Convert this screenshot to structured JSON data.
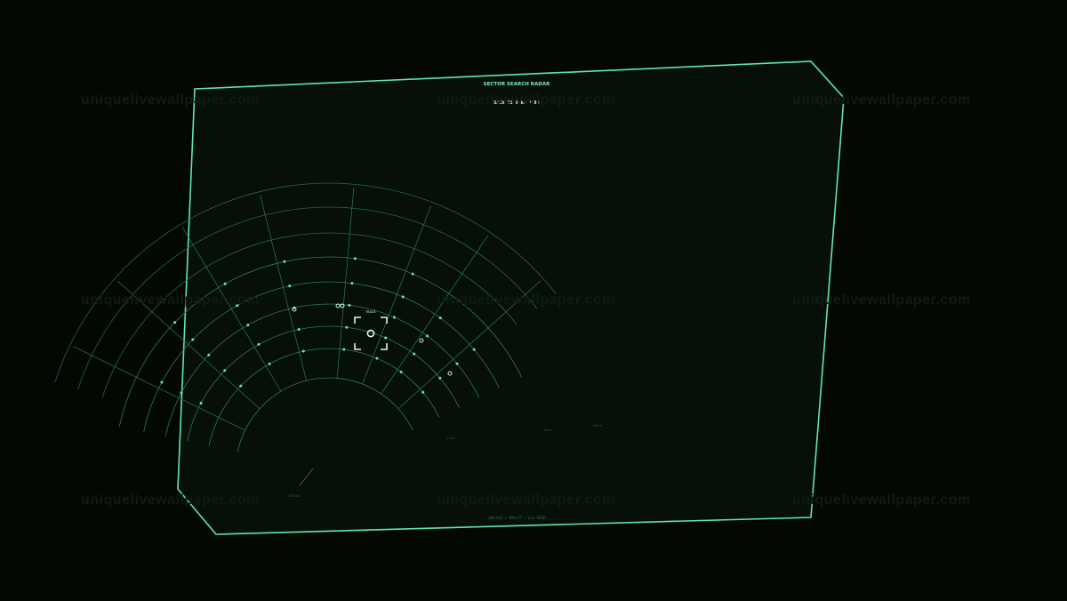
{
  "colors": {
    "background": "#030803",
    "panel_fill": "#060f08",
    "frame": "#5ee8b0",
    "grid": "#2f7a58",
    "node": "#6fe3b4",
    "title": "#7af0c0",
    "faint_text": "#2a5a44",
    "watermark": "#0f1c10"
  },
  "radar": {
    "title": "SECTOR SEARCH RADAR",
    "readout": "SRCH 21.9 km  0.88",
    "target_label": "TRACK",
    "range_labels": [
      "27km",
      "36km",
      "45km"
    ],
    "origin_label": "ORIGIN",
    "footer": "LOW-VIZ  /  PAN.ET  /  pix GRID"
  },
  "watermark": {
    "text": "uniquelivewallpaper.com"
  }
}
